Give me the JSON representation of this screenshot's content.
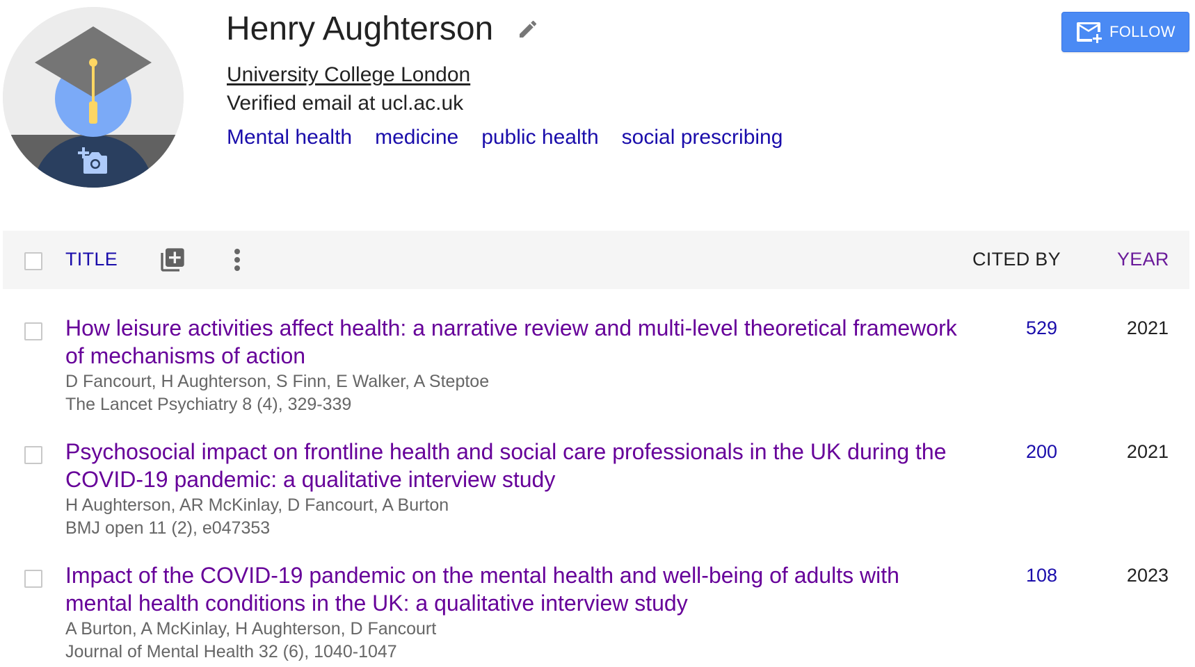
{
  "profile": {
    "name": "Henry Aughterson",
    "affiliation": "University College London",
    "email_status": "Verified email at ucl.ac.uk",
    "interests": [
      "Mental health",
      "medicine",
      "public health",
      "social prescribing"
    ],
    "follow_label": "FOLLOW"
  },
  "colors": {
    "link": "#1a0dab",
    "visited": "#660099",
    "follow_button": "#4a8af4",
    "header_bg": "#f5f5f5"
  },
  "table": {
    "headers": {
      "title": "TITLE",
      "cited_by": "CITED BY",
      "year": "YEAR"
    },
    "rows": [
      {
        "title": "How leisure activities affect health: a narrative review and multi-level theoretical framework of mechanisms of action",
        "authors": "D Fancourt, H Aughterson, S Finn, E Walker, A Steptoe",
        "venue": "The Lancet Psychiatry 8 (4), 329-339",
        "cited_by": "529",
        "year": "2021"
      },
      {
        "title": "Psychosocial impact on frontline health and social care professionals in the UK during the COVID-19 pandemic: a qualitative interview study",
        "authors": "H Aughterson, AR McKinlay, D Fancourt, A Burton",
        "venue": "BMJ open 11 (2), e047353",
        "cited_by": "200",
        "year": "2021"
      },
      {
        "title": "Impact of the COVID-19 pandemic on the mental health and well-being of adults with mental health conditions in the UK: a qualitative interview study",
        "authors": "A Burton, A McKinlay, H Aughterson, D Fancourt",
        "venue": "Journal of Mental Health 32 (6), 1040-1047",
        "cited_by": "108",
        "year": "2023"
      }
    ]
  },
  "icons": {
    "avatar": "graduation-cap-avatar",
    "camera": "add-photo-icon",
    "edit": "pencil-icon",
    "follow": "email-plus-icon",
    "add_article": "library-add-icon",
    "more": "more-vert-icon"
  }
}
